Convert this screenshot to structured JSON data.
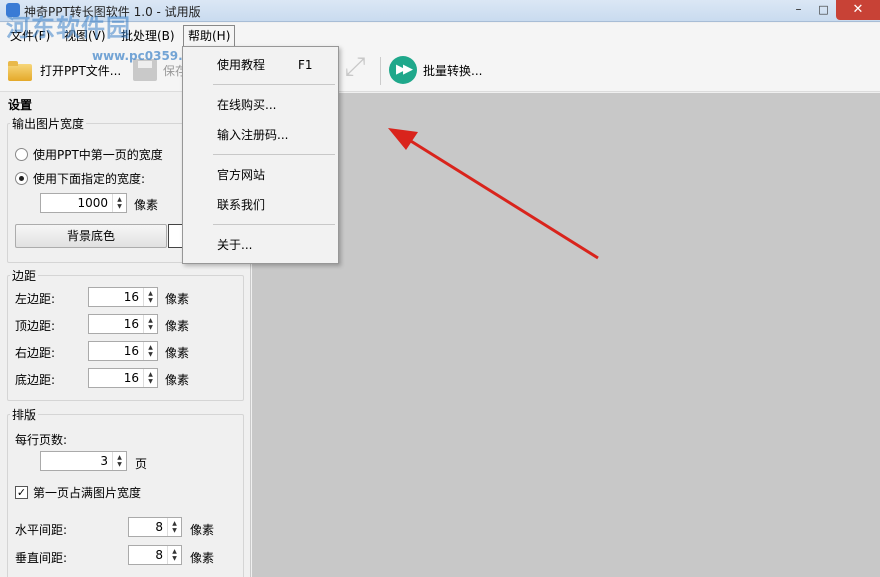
{
  "window": {
    "title": "神奇PPT转长图软件 1.0 - 试用版",
    "close_glyph": "✕",
    "max_glyph": "□",
    "min_glyph": "–"
  },
  "watermark": {
    "text": "河东软件园",
    "url": "www.pc0359.cn"
  },
  "menubar": {
    "items": [
      {
        "label": "文件(F)"
      },
      {
        "label": "视图(V)"
      },
      {
        "label": "批处理(B)"
      },
      {
        "label": "帮助(H)"
      }
    ]
  },
  "toolbar": {
    "open_label": "打开PPT文件...",
    "save_label": "保存",
    "batch_label": "批量转换...",
    "batch_icon": "fast-forward-icon",
    "accent": "#1fa88b"
  },
  "help_menu": {
    "items": [
      {
        "label": "使用教程",
        "shortcut": "F1"
      },
      {
        "label": "在线购买..."
      },
      {
        "label": "输入注册码..."
      },
      {
        "label": "官方网站"
      },
      {
        "label": "联系我们"
      },
      {
        "label": "关于..."
      }
    ]
  },
  "settings": {
    "panel_title": "设置",
    "output_width": {
      "legend": "输出图片宽度",
      "option_first_page": "使用PPT中第一页的宽度",
      "option_custom": "使用下面指定的宽度:",
      "selected": "custom",
      "width_value": "1000",
      "width_unit": "像素",
      "bg_button": "背景底色",
      "bg_color": "#ffffff"
    },
    "margins": {
      "legend": "边距",
      "rows": [
        {
          "label": "左边距:",
          "value": "16",
          "unit": "像素"
        },
        {
          "label": "顶边距:",
          "value": "16",
          "unit": "像素"
        },
        {
          "label": "右边距:",
          "value": "16",
          "unit": "像素"
        },
        {
          "label": "底边距:",
          "value": "16",
          "unit": "像素"
        }
      ]
    },
    "layout": {
      "legend": "排版",
      "pages_per_row_label": "每行页数:",
      "pages_per_row_value": "3",
      "pages_per_row_unit": "页",
      "first_page_full_label": "第一页占满图片宽度",
      "first_page_full_checked": true,
      "h_spacing_label": "水平间距:",
      "h_spacing_value": "8",
      "v_spacing_label": "垂直间距:",
      "v_spacing_value": "8",
      "spacing_unit": "像素"
    }
  },
  "annotation": {
    "color": "#d9241c"
  }
}
